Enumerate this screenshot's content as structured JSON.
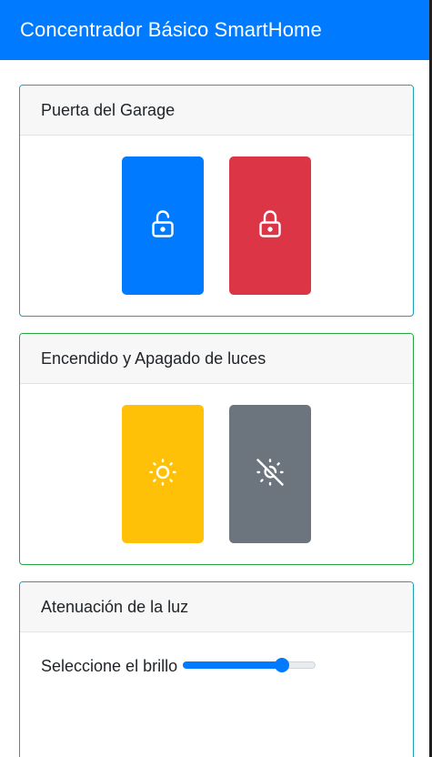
{
  "app": {
    "title": "Concentrador Básico SmartHome"
  },
  "garage": {
    "header": "Puerta del Garage",
    "open_button": {
      "icon": "unlock-icon",
      "color": "#007bff"
    },
    "close_button": {
      "icon": "lock-icon",
      "color": "#dc3545"
    }
  },
  "lights": {
    "header": "Encendido y Apagado de luces",
    "on_button": {
      "icon": "sun-icon",
      "color": "#ffc107"
    },
    "off_button": {
      "icon": "sun-off-icon",
      "color": "#6c757d"
    }
  },
  "dimmer": {
    "header": "Atenuación de la luz",
    "label": "Seleccione el brillo",
    "brightness_fraction": 0.78,
    "accent": "#007bff"
  },
  "colors": {
    "navbar": "#007bff",
    "card_border_info": "#17a2b8",
    "card_border_success": "#28a745"
  }
}
